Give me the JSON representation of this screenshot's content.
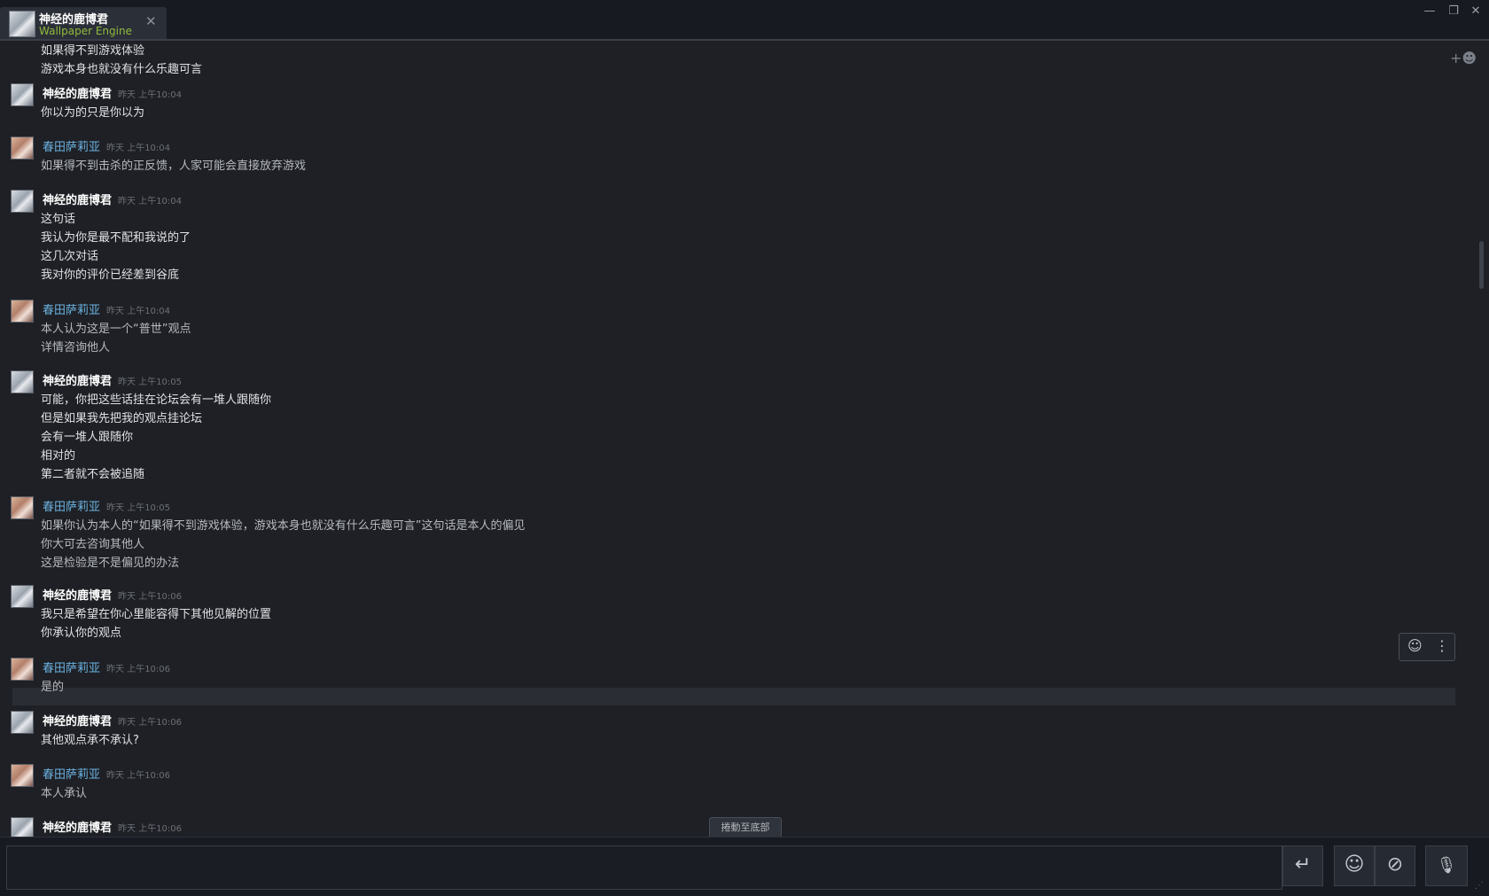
{
  "window": {
    "tab": {
      "name": "神经的鹿博君",
      "game": "Wallpaper Engine",
      "close_glyph": "✕"
    },
    "controls": {
      "minimize": "—",
      "restore": "❐",
      "close": "✕"
    }
  },
  "users": {
    "me": {
      "name": "神经的鹿博君",
      "color": "#ffffff"
    },
    "other": {
      "name": "春田萨莉亚",
      "color": "#6ab0de"
    }
  },
  "top_partial_lines": [
    "如果得不到游戏体验",
    "游戏本身也就没有什么乐趣可言"
  ],
  "messages": [
    {
      "sender": "神经的鹿博君",
      "time": "昨天 上午10:04",
      "lines": [
        "你以为的只是你以为"
      ]
    },
    {
      "sender": "春田萨莉亚",
      "time": "昨天 上午10:04",
      "lines": [
        "如果得不到击杀的正反馈，人家可能会直接放弃游戏"
      ]
    },
    {
      "sender": "神经的鹿博君",
      "time": "昨天 上午10:04",
      "lines": [
        "这句话",
        "我认为你是最不配和我说的了",
        "这几次对话",
        "我对你的评价已经差到谷底"
      ]
    },
    {
      "sender": "春田萨莉亚",
      "time": "昨天 上午10:04",
      "lines": [
        "本人认为这是一个“普世”观点",
        "详情咨询他人"
      ]
    },
    {
      "sender": "神经的鹿博君",
      "time": "昨天 上午10:05",
      "lines": [
        "可能，你把这些话挂在论坛会有一堆人跟随你",
        "但是如果我先把我的观点挂论坛",
        "会有一堆人跟随你",
        "相对的",
        "第二者就不会被追随"
      ]
    },
    {
      "sender": "春田萨莉亚",
      "time": "昨天 上午10:05",
      "lines": [
        "如果你认为本人的“如果得不到游戏体验，游戏本身也就没有什么乐趣可言”这句话是本人的偏见",
        "你大可去咨询其他人",
        "这是检验是不是偏见的办法"
      ]
    },
    {
      "sender": "神经的鹿博君",
      "time": "昨天 上午10:06",
      "lines": [
        "我只是希望在你心里能容得下其他见解的位置",
        "你承认你的观点"
      ]
    },
    {
      "sender": "春田萨莉亚",
      "time": "昨天 上午10:06",
      "lines": [
        "是的"
      ]
    },
    {
      "sender": "神经的鹿博君",
      "time": "昨天 上午10:06",
      "lines": [
        "其他观点承不承认?"
      ]
    },
    {
      "sender": "春田萨莉亚",
      "time": "昨天 上午10:06",
      "lines": [
        "本人承认"
      ]
    },
    {
      "sender": "神经的鹿博君",
      "time": "昨天 上午10:06",
      "lines": []
    }
  ],
  "jump_to_bottom": "捲動至底部",
  "input": {
    "placeholder": ""
  },
  "toolbar": {
    "send_glyph": "↵",
    "emoji_glyph": "☺",
    "attach_glyph": "⊘",
    "voice_glyph": "🎙"
  },
  "reaction_box": {
    "react_glyph": "☺",
    "more_glyph": "⋮"
  }
}
